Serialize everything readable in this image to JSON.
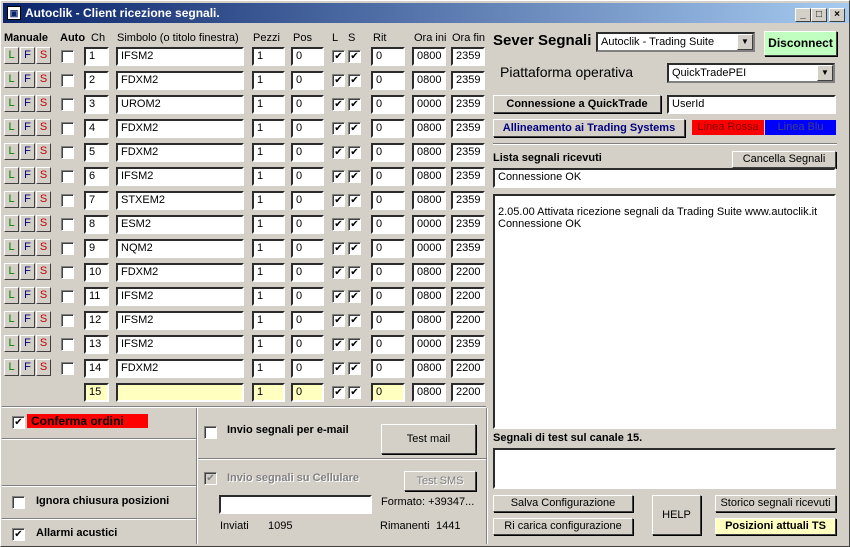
{
  "window": {
    "title": "Autoclik - Client ricezione segnali.",
    "min": "_",
    "max": "□",
    "close": "×"
  },
  "headers": {
    "manuale": "Manuale",
    "auto": "Auto",
    "ch": "Ch",
    "simbolo": "Simbolo (o titolo  finestra)",
    "pezzi": "Pezzi",
    "pos": "Pos",
    "l": "L",
    "s": "S",
    "rit": "Rit",
    "ora_ini": "Ora ini",
    "ora_fin": "Ora fin"
  },
  "lfs": {
    "l": "L",
    "f": "F",
    "s": "S"
  },
  "rows": [
    {
      "ch": "1",
      "sym": "IFSM2",
      "pezzi": "1",
      "pos": "0",
      "rit": "0",
      "ini": "0800",
      "fin": "2359"
    },
    {
      "ch": "2",
      "sym": "FDXM2",
      "pezzi": "1",
      "pos": "0",
      "rit": "0",
      "ini": "0800",
      "fin": "2359"
    },
    {
      "ch": "3",
      "sym": "UROM2",
      "pezzi": "1",
      "pos": "0",
      "rit": "0",
      "ini": "0000",
      "fin": "2359"
    },
    {
      "ch": "4",
      "sym": "FDXM2",
      "pezzi": "1",
      "pos": "0",
      "rit": "0",
      "ini": "0800",
      "fin": "2359"
    },
    {
      "ch": "5",
      "sym": "FDXM2",
      "pezzi": "1",
      "pos": "0",
      "rit": "0",
      "ini": "0800",
      "fin": "2359"
    },
    {
      "ch": "6",
      "sym": "IFSM2",
      "pezzi": "1",
      "pos": "0",
      "rit": "0",
      "ini": "0800",
      "fin": "2359"
    },
    {
      "ch": "7",
      "sym": "STXEM2",
      "pezzi": "1",
      "pos": "0",
      "rit": "0",
      "ini": "0800",
      "fin": "2359"
    },
    {
      "ch": "8",
      "sym": "ESM2",
      "pezzi": "1",
      "pos": "0",
      "rit": "0",
      "ini": "0000",
      "fin": "2359"
    },
    {
      "ch": "9",
      "sym": "NQM2",
      "pezzi": "1",
      "pos": "0",
      "rit": "0",
      "ini": "0000",
      "fin": "2359"
    },
    {
      "ch": "10",
      "sym": "FDXM2",
      "pezzi": "1",
      "pos": "0",
      "rit": "0",
      "ini": "0800",
      "fin": "2200"
    },
    {
      "ch": "11",
      "sym": "IFSM2",
      "pezzi": "1",
      "pos": "0",
      "rit": "0",
      "ini": "0800",
      "fin": "2200"
    },
    {
      "ch": "12",
      "sym": "IFSM2",
      "pezzi": "1",
      "pos": "0",
      "rit": "0",
      "ini": "0800",
      "fin": "2200"
    },
    {
      "ch": "13",
      "sym": "IFSM2",
      "pezzi": "1",
      "pos": "0",
      "rit": "0",
      "ini": "0000",
      "fin": "2359"
    },
    {
      "ch": "14",
      "sym": "FDXM2",
      "pezzi": "1",
      "pos": "0",
      "rit": "0",
      "ini": "0800",
      "fin": "2200"
    },
    {
      "ch": "15",
      "sym": "",
      "pezzi": "1",
      "pos": "0",
      "rit": "0",
      "ini": "0800",
      "fin": "2200"
    }
  ],
  "right": {
    "server_label": "Sever Segnali",
    "server_value": "Autoclik - Trading Suite",
    "disconnect": "Disconnect",
    "piattaforma_label": "Piattaforma operativa",
    "piattaforma_value": "QuickTradePEI",
    "connessione_btn": "Connessione a QuickTrade",
    "userid": "UserId",
    "allineamento_btn": "Allineamento ai Trading Systems",
    "linea_rossa": "Linea Rossa",
    "linea_blu": "Linea Blu",
    "lista_label": "Lista segnali ricevuti",
    "cancella_btn": "Cancella Segnali",
    "status": "Connessione OK",
    "log_line1": "2.05.00 Attivata ricezione segnali da Trading Suite www.autoclik.it",
    "log_line2": "Connessione OK",
    "test_label": "Segnali di test sul canale 15.",
    "salva_btn": "Salva Configurazione",
    "ricarica_btn": "Ri carica configurazione",
    "help_btn": "HELP",
    "storico_btn": "Storico segnali ricevuti",
    "posizioni_btn": "Posizioni attuali TS"
  },
  "bottom": {
    "conferma": "Conferma ordini",
    "ignora": "Ignora chiusura posizioni",
    "allarmi": "Allarmi acustici",
    "email": "Invio segnali per e-mail",
    "test_mail": "Test mail",
    "cellulare": "Invio segnali su Cellulare",
    "test_sms": "Test SMS",
    "formato": "Formato: +39347...",
    "inviati_label": "Inviati",
    "inviati_val": "1095",
    "rimanenti_label": "Rimanenti",
    "rimanenti_val": "1441"
  },
  "colors": {
    "red": "#ff0000",
    "blue": "#0000ff",
    "lfs_l": "#008000",
    "lfs_f": "#000080",
    "lfs_s": "#c00000"
  }
}
